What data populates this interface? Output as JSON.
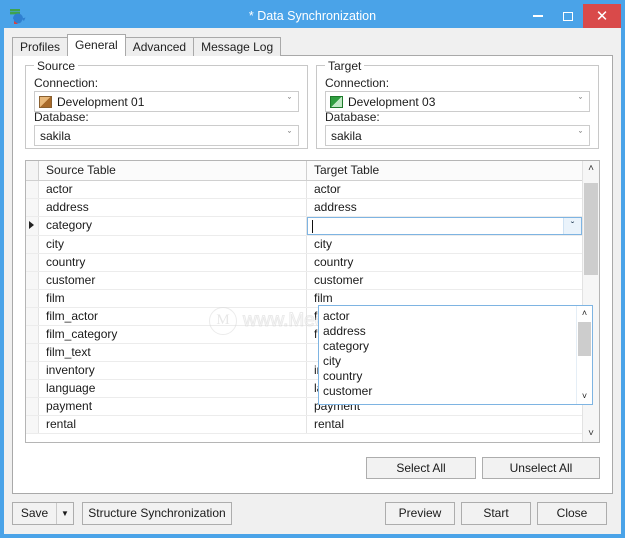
{
  "window": {
    "title": "* Data Synchronization",
    "app_icon": "data-sync-icon",
    "accent_color": "#4aa3e8",
    "close_color": "#d94a4a",
    "controls": {
      "minimize": "minimize-icon",
      "maximize": "maximize-icon",
      "close": "✕"
    }
  },
  "tabs": [
    {
      "label": "Profiles",
      "active": false
    },
    {
      "label": "General",
      "active": true
    },
    {
      "label": "Advanced",
      "active": false
    },
    {
      "label": "Message Log",
      "active": false
    }
  ],
  "source": {
    "group_title": "Source",
    "connection_label": "Connection:",
    "connection_value": "Development 01",
    "connection_icon": "brown-connection-icon",
    "database_label": "Database:",
    "database_value": "sakila",
    "arrow": "ˇ"
  },
  "target": {
    "group_title": "Target",
    "connection_label": "Connection:",
    "connection_value": "Development 03",
    "connection_icon": "green-connection-icon",
    "database_label": "Database:",
    "database_value": "sakila",
    "arrow": "ˇ"
  },
  "grid": {
    "columns": [
      "Source Table",
      "Target Table"
    ],
    "current_row_index": 2,
    "editing_row_index": 2,
    "editor_value": "",
    "rows": [
      {
        "source": "actor",
        "target": "actor"
      },
      {
        "source": "address",
        "target": "address"
      },
      {
        "source": "category",
        "target": ""
      },
      {
        "source": "city",
        "target": "city"
      },
      {
        "source": "country",
        "target": "country"
      },
      {
        "source": "customer",
        "target": "customer"
      },
      {
        "source": "film",
        "target": "film"
      },
      {
        "source": "film_actor",
        "target": "film_actor"
      },
      {
        "source": "film_category",
        "target": "film_category"
      },
      {
        "source": "film_text",
        "target": ""
      },
      {
        "source": "inventory",
        "target": "inventory"
      },
      {
        "source": "language",
        "target": "language"
      },
      {
        "source": "payment",
        "target": "payment"
      },
      {
        "source": "rental",
        "target": "rental"
      }
    ],
    "scrollbar": {
      "up_arrow": "˄",
      "down_arrow": "˅"
    }
  },
  "dropdown": {
    "open": true,
    "items": [
      "actor",
      "address",
      "category",
      "city",
      "country",
      "customer"
    ],
    "up_arrow": "˄",
    "down_arrow": "˅"
  },
  "grid_buttons": {
    "select_all": "Select All",
    "unselect_all": "Unselect All"
  },
  "bottom_bar": {
    "save": "Save",
    "save_arrow": "▼",
    "structure_synchronization": "Structure Synchronization",
    "preview": "Preview",
    "start": "Start",
    "close": "Close"
  },
  "watermark": {
    "mark": "M",
    "text": "www.MeeDown.com"
  }
}
